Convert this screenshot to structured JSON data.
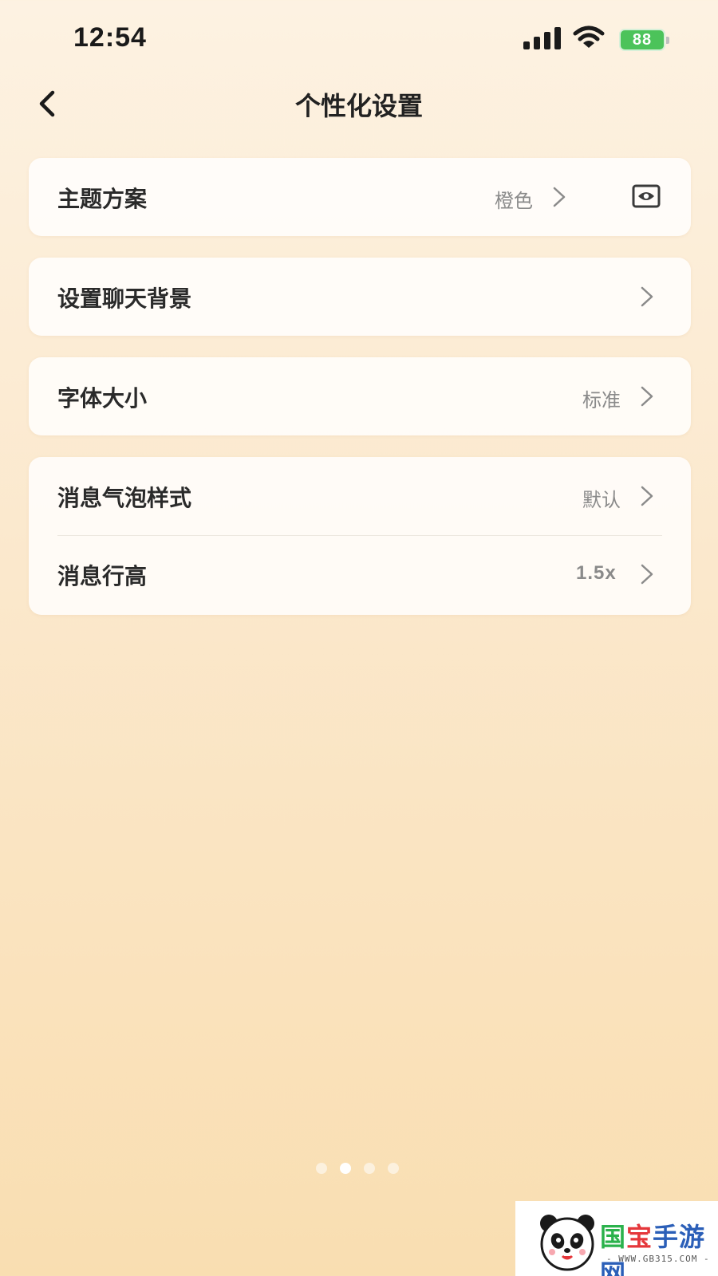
{
  "status_bar": {
    "time": "12:54",
    "battery": "88"
  },
  "nav": {
    "title": "个性化设置"
  },
  "settings": {
    "theme": {
      "label": "主题方案",
      "value": "橙色"
    },
    "chat_background": {
      "label": "设置聊天背景"
    },
    "font_size": {
      "label": "字体大小",
      "value": "标准"
    },
    "bubble_style": {
      "label": "消息气泡样式",
      "value": "默认"
    },
    "line_height": {
      "label": "消息行高",
      "value": "1.5x"
    }
  },
  "pager": {
    "count": 4,
    "active_index": 1
  },
  "watermark": {
    "logo_text_1": "国",
    "logo_text_2": "宝",
    "logo_text_3": "手游网",
    "url": "- WWW.GB315.COM -"
  },
  "icons": {
    "back": "chevron-left-icon",
    "chevron": "chevron-right-icon",
    "preview": "eye-icon",
    "signal": "signal-icon",
    "wifi": "wifi-icon"
  },
  "colors": {
    "battery": "#4cc35a",
    "background_top": "#fdf2e2",
    "background_bottom": "#f9deb1"
  }
}
